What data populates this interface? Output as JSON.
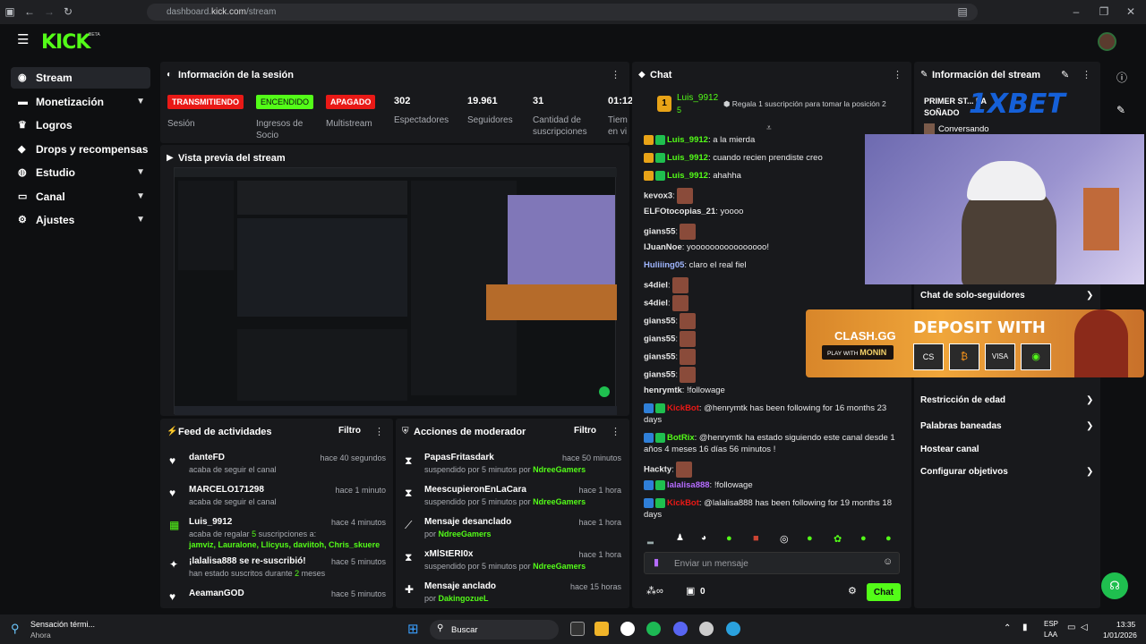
{
  "browser": {
    "url_prefix": "dashboard.",
    "url_domain": "kick.com",
    "url_path": "/stream"
  },
  "logo": "KICK",
  "logo_beta": "BETA",
  "sidebar": {
    "items": [
      {
        "label": "Stream",
        "icon": "broadcast-icon",
        "active": true,
        "has_chevron": false
      },
      {
        "label": "Monetización",
        "icon": "money-icon",
        "has_chevron": true
      },
      {
        "label": "Logros",
        "icon": "trophy-icon",
        "has_chevron": false
      },
      {
        "label": "Drops y recompensas",
        "icon": "gift-icon",
        "has_chevron": false
      },
      {
        "label": "Estudio",
        "icon": "studio-icon",
        "has_chevron": true
      },
      {
        "label": "Canal",
        "icon": "channel-icon",
        "has_chevron": true
      },
      {
        "label": "Ajustes",
        "icon": "gear-icon",
        "has_chevron": true
      }
    ]
  },
  "session": {
    "title": "Información de la sesión",
    "badges": [
      {
        "label": "TRANSMITIENDO",
        "caption": "Sesión",
        "color": "#e91916"
      },
      {
        "label": "ENCENDIDO",
        "caption": "Ingresos de Socio",
        "color": "#53fc18"
      },
      {
        "label": "APAGADO",
        "caption": "Multistream",
        "color": "#e91916"
      }
    ],
    "stats": [
      {
        "value": "302",
        "label": "Espectadores"
      },
      {
        "value": "19.961",
        "label": "Seguidores"
      },
      {
        "value": "31",
        "label": "Cantidad de suscripciones"
      },
      {
        "value": "01:12",
        "label": "Tiem en vi"
      }
    ]
  },
  "preview": {
    "title": "Vista previa del stream"
  },
  "feed": {
    "title": "Feed de actividades",
    "filter": "Filtro",
    "items": [
      {
        "name": "danteFD",
        "sub": "acaba de seguir el canal",
        "time": "hace 40 segundos",
        "icon": "heart-icon"
      },
      {
        "name": "MARCELO171298",
        "sub": "acaba de seguir el canal",
        "time": "hace 1 minuto",
        "icon": "heart-icon"
      },
      {
        "name": "Luis_9912",
        "sub_pre": "acaba de regalar ",
        "sub_count": "5",
        "sub_post": " suscripciones a:",
        "recipients": "jamviz, Lauralone, Llicyus, daviitoh, Chris_skuere",
        "time": "hace 4 minutos",
        "icon": "gift-icon"
      },
      {
        "name": "¡lalalisa888 se re-suscribió!",
        "sub_pre": "han estado suscritos durante ",
        "sub_count": "2",
        "sub_post": " meses",
        "time": "hace 5 minutos",
        "icon": "star-icon"
      },
      {
        "name": "AeamanGOD",
        "sub": "",
        "time": "hace 5 minutos",
        "icon": "heart-icon"
      }
    ]
  },
  "mod": {
    "title": "Acciones de moderador",
    "filter": "Filtro",
    "items": [
      {
        "name": "PapasFritasdark",
        "sub": "suspendido por 5 minutos por ",
        "by": "NdreeGamers",
        "time": "hace 50 minutos",
        "icon": "hourglass-icon"
      },
      {
        "name": "MeescupieronEnLaCara",
        "sub": "suspendido por 5 minutos por ",
        "by": "NdreeGamers",
        "time": "hace 1 hora",
        "icon": "hourglass-icon"
      },
      {
        "name": "Mensaje desanclado",
        "sub": "por ",
        "by": "NdreeGamers",
        "time": "hace 1 hora",
        "icon": "unpin-icon"
      },
      {
        "name": "xMlStERI0x",
        "sub": "suspendido por 5 minutos por ",
        "by": "NdreeGamers",
        "time": "hace 1 hora",
        "icon": "hourglass-icon"
      },
      {
        "name": "Mensaje anclado",
        "sub": "por ",
        "by": "DakingozueL",
        "time": "hace 15 horas",
        "icon": "pin-icon"
      }
    ]
  },
  "chat": {
    "title": "Chat",
    "pinned": {
      "user": "Luis_9912",
      "count": "5",
      "gift_text": "Regala 1 suscripción para tomar la posición 2"
    },
    "messages": [
      {
        "user": "Luis_9912",
        "color": "#53fc18",
        "text": ": a la mierda",
        "badges": 2
      },
      {
        "user": "Luis_9912",
        "color": "#53fc18",
        "text": ": cuando recien prendiste creo",
        "badges": 2
      },
      {
        "user": "Luis_9912",
        "color": "#53fc18",
        "text": ": ahahha",
        "badges": 2
      },
      {
        "user": "kevox3",
        "color": "#e8e8e8",
        "text": ":",
        "emote": true
      },
      {
        "user": "ELFOtocopias_21",
        "color": "#e8e8e8",
        "text": ": yoooo"
      },
      {
        "user": "gians55",
        "color": "#e8e8e8",
        "text": ":",
        "emote": true
      },
      {
        "user": "lJuanNoe",
        "color": "#e8e8e8",
        "text": ": yoooooooooooooooo!"
      },
      {
        "user": "Huliiing05",
        "color": "#9fb6ff",
        "text": ": claro el real fiel"
      },
      {
        "user": "s4diel",
        "color": "#e8e8e8",
        "text": ":",
        "emote": true
      },
      {
        "user": "s4diel",
        "color": "#e8e8e8",
        "text": ":",
        "emote": true
      },
      {
        "user": "gians55",
        "color": "#e8e8e8",
        "text": ":",
        "emote": true
      },
      {
        "user": "gians55",
        "color": "#e8e8e8",
        "text": ":",
        "emote": true
      },
      {
        "user": "gians55",
        "color": "#e8e8e8",
        "text": ":",
        "emote": true
      },
      {
        "user": "gians55",
        "color": "#e8e8e8",
        "text": ":",
        "emote": true
      },
      {
        "user": "henrymtk",
        "color": "#e8e8e8",
        "text": ": !followage"
      },
      {
        "user": "KickBot",
        "color": "#e91916",
        "text": ": @henrymtk has been following for 16 months 23",
        "text2": "days",
        "badges": 2
      },
      {
        "user": "BotRix",
        "color": "#53fc18",
        "text": ": @henrymtk ha estado siguiendo este canal desde 1",
        "text2": "años 4 meses 16 días 56 minutos !",
        "badges": 2
      },
      {
        "user": "Hackty",
        "color": "#e8e8e8",
        "text": ":",
        "emote": true
      },
      {
        "user": "lalalisa888",
        "color": "#b56cff",
        "text": ": !followage",
        "badges": 2
      },
      {
        "user": "KickBot",
        "color": "#e91916",
        "text": ": @lalalisa888 has been following for 19 months 18",
        "text2": "days",
        "badges": 2
      }
    ],
    "input_placeholder": "Enviar un mensaje",
    "points": "0",
    "send_label": "Chat"
  },
  "stream_info": {
    "title": "Información del stream",
    "stream_title": "PRIMER ST... LA SOÑADO",
    "sponsor": "1XBET",
    "category": "Conversando",
    "menu": [
      {
        "label": "Chat de solo-seguidores",
        "chevron": true
      },
      {
        "label": "Restricción de edad",
        "chevron": true
      },
      {
        "label": "Palabras baneadas",
        "chevron": true
      },
      {
        "label": "Hostear canal",
        "chevron": false
      },
      {
        "label": "Configurar objetivos",
        "chevron": true
      }
    ]
  },
  "ad": {
    "brand": "CLASH.GG",
    "tag": "PLAY WITH",
    "code": "MONIN",
    "headline": "DEPOSIT WITH",
    "methods": [
      "CS",
      "₿",
      "VISA",
      "◉"
    ]
  },
  "taskbar": {
    "weather_title": "Sensación térmi...",
    "weather_sub": "Ahora",
    "search": "Buscar",
    "lang1": "ESP",
    "lang2": "LAA",
    "time": "13:35",
    "date": "1/01/2026"
  }
}
